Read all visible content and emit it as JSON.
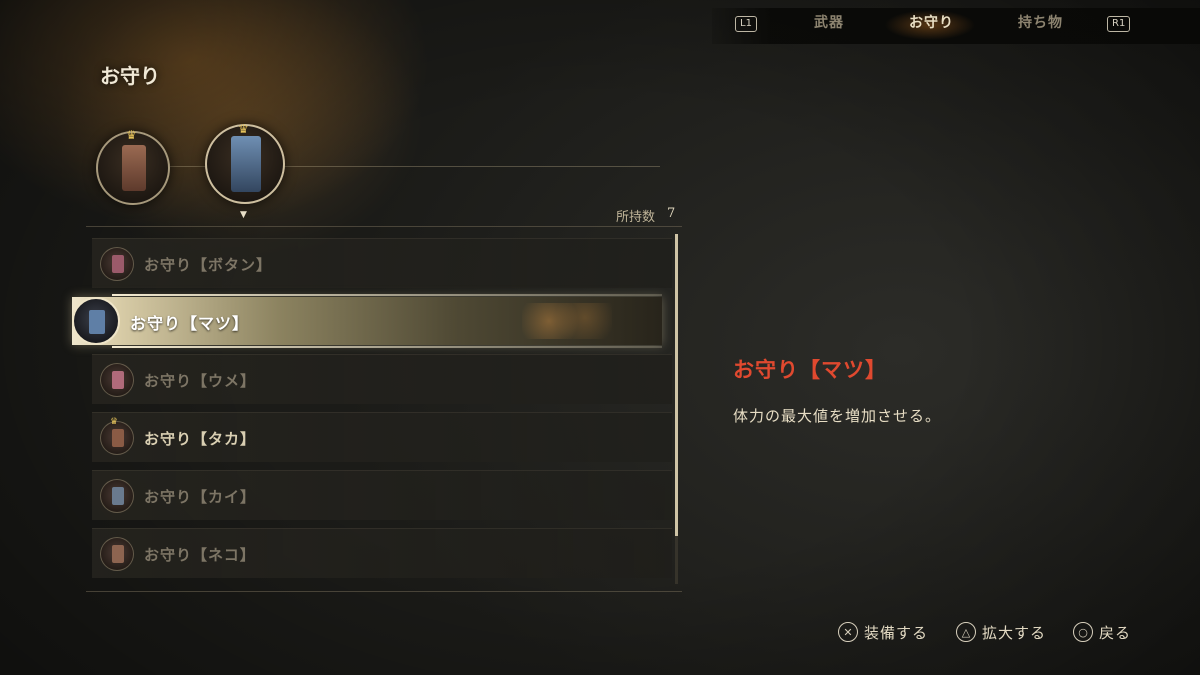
{
  "tabs": {
    "l1": "L1",
    "r1": "R1",
    "items": [
      {
        "label": "武器",
        "active": false
      },
      {
        "label": "お守り",
        "active": true
      },
      {
        "label": "持ち物",
        "active": false
      }
    ]
  },
  "header": {
    "title": "お守り"
  },
  "equipped_medals": [
    {
      "icon": "brown-charm-icon",
      "color": "#8a5b45"
    },
    {
      "icon": "blue-dragon-charm-icon",
      "color": "#4d6a8c"
    }
  ],
  "inventory": {
    "count_label": "所持数",
    "count_value": "7"
  },
  "list": {
    "items": [
      {
        "label": "お守り【ボタン】",
        "color": "#9b5a6a",
        "owned": false
      },
      {
        "label": "お守り【マツ】",
        "color": "#5f7fa6",
        "owned": true,
        "selected": true
      },
      {
        "label": "お守り【ウメ】",
        "color": "#b06a7a",
        "owned": false
      },
      {
        "label": "お守り【タカ】",
        "color": "#8a5b45",
        "owned": true,
        "equipped": true
      },
      {
        "label": "お守り【カイ】",
        "color": "#6a7a8e",
        "owned": false
      },
      {
        "label": "お守り【ネコ】",
        "color": "#8d6450",
        "owned": false
      }
    ]
  },
  "detail": {
    "name": "お守り【マツ】",
    "description": "体力の最大値を増加させる。"
  },
  "prompts": [
    {
      "icon": "cross-button-icon",
      "glyph": "✕",
      "label": "装備する"
    },
    {
      "icon": "triangle-button-icon",
      "glyph": "△",
      "label": "拡大する"
    },
    {
      "icon": "circle-button-icon",
      "glyph": "○",
      "label": "戻る"
    }
  ]
}
